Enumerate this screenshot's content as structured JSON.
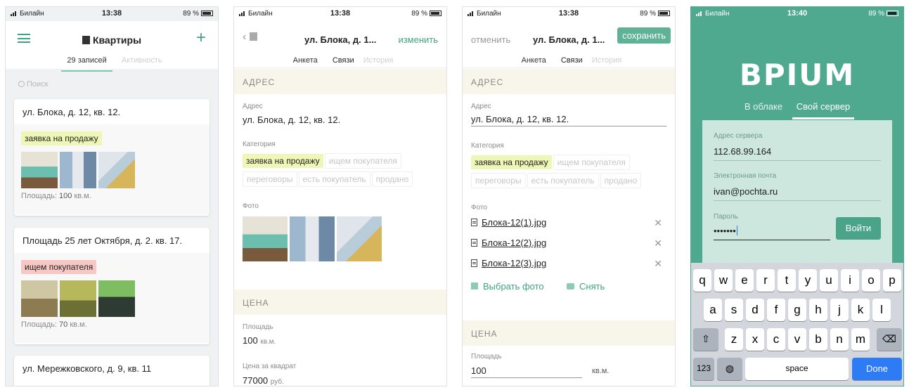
{
  "status": {
    "carrier": "Билайн",
    "battery": "89 %",
    "time_1": "13:38",
    "time_2": "13:38",
    "time_3": "13:38",
    "time_4": "13:40"
  },
  "screen1": {
    "title": "Квартиры",
    "tabs": [
      "29 записей",
      "Активность"
    ],
    "search_placeholder": "Поиск",
    "area_label": "Площадь:",
    "unit": "кв.м.",
    "cards": [
      {
        "title": "ул. Блока, д. 12, кв. 12.",
        "tag": "заявка на продажу",
        "tag_color": "#eef7b6",
        "area": "100"
      },
      {
        "title": "Площадь 25 лет Октября, д. 2. кв. 17.",
        "tag": "ищем покупателя",
        "tag_color": "#f7c7c3",
        "area": "70"
      },
      {
        "title": "ул. Мережковского, д. 9, кв. 11"
      }
    ]
  },
  "screen2": {
    "title": "ул. Блока, д. 1...",
    "edit": "изменить",
    "tabs": [
      "Анкета",
      "Связи",
      "История"
    ],
    "section_address": "АДРЕС",
    "address_label": "Адрес",
    "address_value": "ул. Блока, д. 12, кв. 12.",
    "category_label": "Категория",
    "categories": [
      "заявка на продажу",
      "ищем покупателя",
      "переговоры",
      "есть покупатель",
      "продано"
    ],
    "photo_label": "Фото",
    "section_price": "ЦЕНА",
    "area_label": "Площадь",
    "area_value": "100",
    "area_unit": "кв.м.",
    "price_sqm_label": "Цена за квадрат",
    "price_sqm_value": "77000",
    "price_unit": "руб."
  },
  "screen3": {
    "cancel": "отменить",
    "title": "ул. Блока, д. 1...",
    "save": "сохранить",
    "tabs": [
      "Анкета",
      "Связи",
      "История"
    ],
    "section_address": "АДРЕС",
    "address_label": "Адрес",
    "address_value": "ул. Блока, д. 12, кв. 12.",
    "category_label": "Категория",
    "categories": [
      "заявка на продажу",
      "ищем покупателя",
      "переговоры",
      "есть покупатель",
      "продано"
    ],
    "photo_label": "Фото",
    "files": [
      "Блока-12(1).jpg",
      "Блока-12(2).jpg",
      "Блока-12(3).jpg"
    ],
    "choose_photo": "Выбрать фото",
    "take_photo": "Снять",
    "section_price": "ЦЕНА",
    "area_label": "Площадь",
    "area_value": "100",
    "area_unit": "кв.м."
  },
  "screen4": {
    "logo": "BPIUM",
    "tabs": [
      "В облаке",
      "Свой сервер"
    ],
    "server_label": "Адрес сервера",
    "server_value": "112.68.99.164",
    "email_label": "Электронная почта",
    "email_value": "ivan@pochta.ru",
    "password_label": "Пароль",
    "password_value": "•••••••",
    "login": "Войти",
    "keys_row1": [
      "q",
      "w",
      "e",
      "r",
      "t",
      "y",
      "u",
      "i",
      "o",
      "p"
    ],
    "keys_row2": [
      "a",
      "s",
      "d",
      "f",
      "g",
      "h",
      "j",
      "k",
      "l"
    ],
    "keys_row3": [
      "z",
      "x",
      "c",
      "v",
      "b",
      "n",
      "m"
    ],
    "key_numbers": "123",
    "key_space": "space",
    "key_done": "Done"
  },
  "colors": {
    "accent_green": "#3ea283",
    "brand_green": "#4fa98f",
    "tag_yellow": "#eef7b6",
    "tag_red": "#f7c7c3"
  }
}
